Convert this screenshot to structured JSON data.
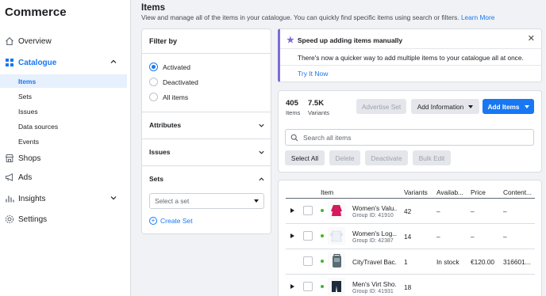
{
  "sidebar": {
    "title": "Commerce",
    "items": [
      {
        "label": "Overview",
        "icon": "home-icon"
      },
      {
        "label": "Catalogue",
        "icon": "grid-icon",
        "active": true
      },
      {
        "label": "Shops",
        "icon": "shop-icon"
      },
      {
        "label": "Ads",
        "icon": "megaphone-icon"
      },
      {
        "label": "Insights",
        "icon": "bar-chart-icon"
      },
      {
        "label": "Settings",
        "icon": "gear-icon"
      }
    ],
    "catalogue_sub": [
      "Items",
      "Sets",
      "Issues",
      "Data sources",
      "Events"
    ]
  },
  "header": {
    "title": "Items",
    "description": "View and manage all of the items in your catalogue. You can quickly find specific items using search or filters.",
    "learn_more": "Learn More"
  },
  "filter": {
    "title": "Filter by",
    "status_options": [
      {
        "label": "Activated",
        "selected": true
      },
      {
        "label": "Deactivated",
        "selected": false
      },
      {
        "label": "All items",
        "selected": false
      }
    ],
    "sections": [
      "Attributes",
      "Issues",
      "Sets"
    ],
    "set_placeholder": "Select a set",
    "create_set": "Create Set"
  },
  "notice": {
    "title": "Speed up adding items manually",
    "body": "There's now a quicker way to add multiple items to your catalogue all at once.",
    "link": "Try It Now"
  },
  "summary": {
    "items_count": "405",
    "items_label": "Items",
    "variants_count": "7.5K",
    "variants_label": "Variants",
    "advertise_set": "Advertise Set",
    "add_information": "Add Information",
    "add_items": "Add Items",
    "search_placeholder": "Search all items",
    "select_all": "Select All",
    "delete": "Delete",
    "deactivate": "Deactivate",
    "bulk_edit": "Bulk Edit"
  },
  "table": {
    "columns": [
      "Item",
      "Variants",
      "Availab...",
      "Price",
      "Content..."
    ],
    "rows": [
      {
        "name": "Women's Valu...",
        "group": "Group ID: 41910",
        "variants": "42",
        "availability": "–",
        "price": "–",
        "content": "–",
        "expandable": true,
        "thumb_color": "#d81b60"
      },
      {
        "name": "Women's Log...",
        "group": "Group ID: 42387",
        "variants": "14",
        "availability": "–",
        "price": "–",
        "content": "–",
        "expandable": true,
        "thumb_color": "#e8eef6"
      },
      {
        "name": "CityTravel Bac...",
        "group": "",
        "variants": "1",
        "availability": "In stock",
        "price": "€120.00",
        "content": "316601...",
        "expandable": false,
        "thumb_color": "#5b6b73"
      },
      {
        "name": "Men's Virt Sho...",
        "group": "Group ID: 41931",
        "variants": "18",
        "availability": "–",
        "price": "–",
        "content": "–",
        "expandable": true,
        "thumb_color": "#1f2a3a"
      }
    ]
  },
  "colors": {
    "accent": "#1877f2",
    "notice_accent": "#7b6cd9",
    "status_active": "#42b72a"
  }
}
